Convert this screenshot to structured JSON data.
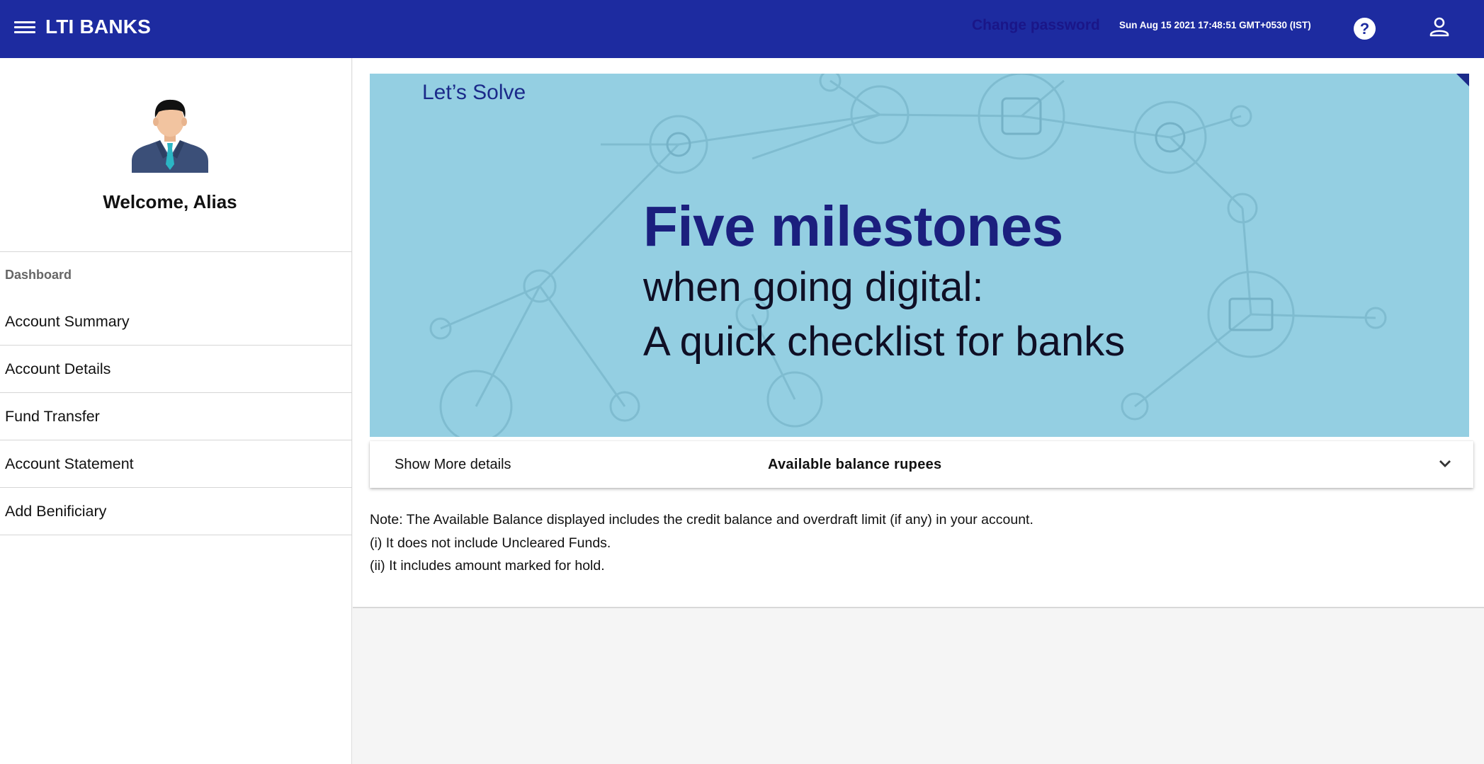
{
  "header": {
    "brand": "LTI BANKS",
    "change_password": "Change password",
    "datetime": "Sun Aug 15 2021 17:48:51 GMT+0530 (IST)",
    "help_icon": "?",
    "accent_color": "#1d2ba0"
  },
  "sidebar": {
    "welcome": "Welcome, Alias",
    "section_label": "Dashboard",
    "items": [
      {
        "label": "Account Summary"
      },
      {
        "label": "Account Details"
      },
      {
        "label": "Fund Transfer"
      },
      {
        "label": "Account Statement"
      },
      {
        "label": "Add Benificiary"
      }
    ]
  },
  "banner": {
    "tag": "Let’s Solve",
    "headline": "Five milestones",
    "subline1": "when going digital:",
    "subline2": "A quick checklist for banks"
  },
  "panel": {
    "show_more": "Show More details",
    "balance_label": "Available balance rupees"
  },
  "notes": [
    "Note: The Available Balance displayed includes the credit balance and overdraft limit (if any) in your account.",
    "(i) It does not include Uncleared Funds.",
    "(ii) It includes amount marked for hold."
  ]
}
